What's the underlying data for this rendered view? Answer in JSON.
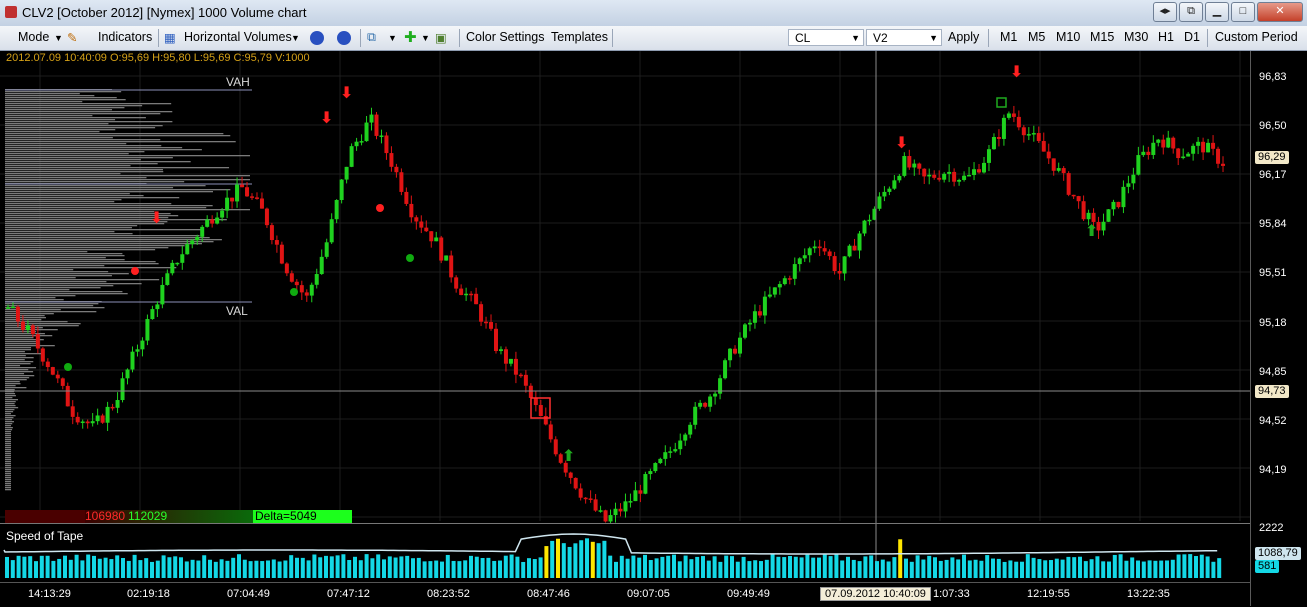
{
  "window": {
    "title": "CLV2 [October 2012] [Nymex] 1000 Volume chart"
  },
  "toolbar": {
    "mode": "Mode",
    "indicators": "Indicators",
    "horizontal_volumes": "Horizontal Volumes",
    "color_settings": "Color Settings",
    "templates": "Templates",
    "symbol": "CL",
    "contract": "V2",
    "apply": "Apply",
    "periods": [
      "M1",
      "M5",
      "M10",
      "M15",
      "M30",
      "H1",
      "D1"
    ],
    "custom_period": "Custom Period"
  },
  "info_bar": "2012.07.09 10:40:09  O:95,69  H:95,80  L:95,69  C:95,79  V:1000",
  "profile": {
    "vah": "VAH",
    "val": "VAL"
  },
  "delta": {
    "sell": "106980",
    "buy": "112029",
    "delta": "Delta=5049"
  },
  "speed_of_tape": {
    "label": "Speed of Tape",
    "max": "2222",
    "avg": "1088,79",
    "current": "581"
  },
  "price_axis": {
    "labels": [
      "96,83",
      "96,50",
      "96,17",
      "95,84",
      "95,51",
      "95,18",
      "94,85",
      "94,52",
      "94,19"
    ],
    "current_price": "96,29",
    "crosshair_price": "94,73"
  },
  "time_axis": {
    "labels": [
      "14:13:29",
      "02:19:18",
      "07:04:49",
      "07:47:12",
      "08:23:52",
      "08:47:46",
      "09:07:05",
      "09:49:49",
      "1:07:33",
      "12:19:55",
      "13:22:35"
    ],
    "crosshair_time": "07.09.2012 10:40:09"
  },
  "colors": {
    "up": "#1fd21f",
    "down": "#e01414",
    "tape_bar": "#14d8e6",
    "tape_spike": "#ffe600",
    "info": "#d4a017"
  },
  "chart_data": {
    "type": "candlestick",
    "close_path": [
      95.45,
      95.3,
      95.1,
      94.85,
      94.75,
      94.9,
      95.2,
      95.5,
      95.75,
      95.9,
      96.05,
      96.15,
      96.0,
      95.7,
      95.5,
      95.85,
      96.35,
      96.55,
      96.3,
      96.0,
      95.85,
      95.6,
      95.45,
      95.2,
      95.05,
      94.8,
      94.55,
      94.35,
      94.2,
      94.3,
      94.45,
      94.6,
      94.8,
      94.95,
      95.2,
      95.4,
      95.55,
      95.7,
      95.85,
      95.65,
      95.9,
      96.1,
      96.3,
      96.2,
      96.25,
      96.2,
      96.35,
      96.6,
      96.45,
      96.3,
      96.1,
      95.9,
      96.05,
      96.3,
      96.45,
      96.35,
      96.4,
      96.3
    ],
    "ylim": [
      94.0,
      96.95
    ]
  }
}
